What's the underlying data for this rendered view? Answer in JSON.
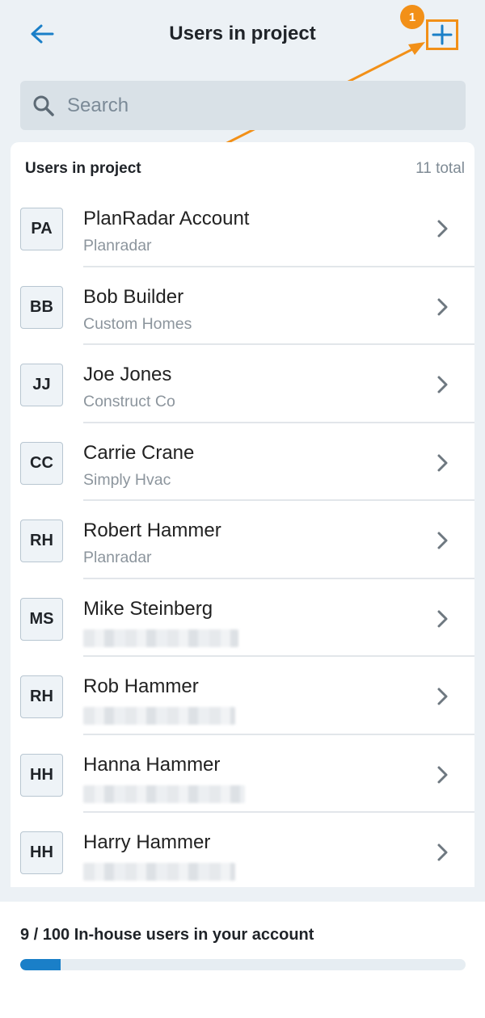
{
  "header": {
    "title": "Users in project",
    "back_icon": "arrow-left-icon",
    "add_icon": "plus-icon",
    "callout_number": "1",
    "accent_color": "#1a7fc8",
    "callout_color": "#f29018"
  },
  "search": {
    "placeholder": "Search",
    "value": ""
  },
  "list": {
    "section_title": "Users in project",
    "total_label": "11 total",
    "users": [
      {
        "initials": "PA",
        "name": "PlanRadar Account",
        "company": "Planradar"
      },
      {
        "initials": "BB",
        "name": "Bob Builder",
        "company": "Custom Homes"
      },
      {
        "initials": "JJ",
        "name": "Joe Jones",
        "company": "Construct Co"
      },
      {
        "initials": "CC",
        "name": "Carrie Crane",
        "company": "Simply Hvac"
      },
      {
        "initials": "RH",
        "name": "Robert Hammer",
        "company": "Planradar"
      },
      {
        "initials": "MS",
        "name": "Mike Steinberg",
        "company": null
      },
      {
        "initials": "RH",
        "name": "Rob Hammer",
        "company": null
      },
      {
        "initials": "HH",
        "name": "Hanna Hammer",
        "company": null
      },
      {
        "initials": "HH",
        "name": "Harry Hammer",
        "company": null
      }
    ]
  },
  "footer": {
    "usage_label": "9 / 100 In-house users in your account",
    "usage_fraction": 0.09
  }
}
